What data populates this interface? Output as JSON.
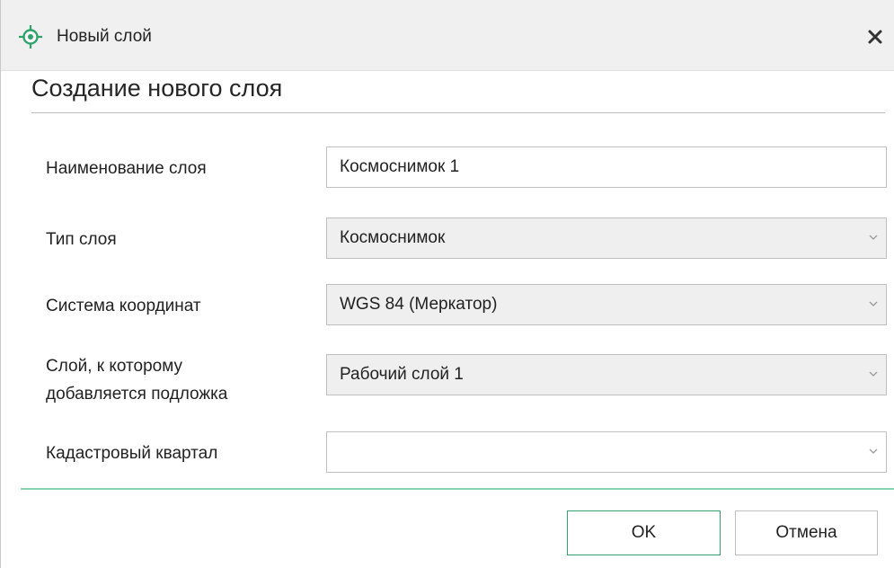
{
  "window": {
    "title": "Новый слой",
    "accent_color": "#2fa36b"
  },
  "dialog": {
    "heading": "Создание нового слоя"
  },
  "form": {
    "layer_name": {
      "label": "Наименование слоя",
      "value": "Космоснимок 1"
    },
    "layer_type": {
      "label": "Тип слоя",
      "value": "Космоснимок"
    },
    "coord_system": {
      "label": "Система координат",
      "value": "WGS 84 (Меркатор)"
    },
    "target_layer": {
      "label_line1": "Слой, к которому",
      "label_line2": "добавляется подложка",
      "value": "Рабочий слой 1"
    },
    "cadastral_block": {
      "label": "Кадастровый квартал",
      "value": ""
    }
  },
  "buttons": {
    "ok": "OK",
    "cancel": "Отмена"
  },
  "icons": {
    "app": "layer-crosshair-icon",
    "close": "close-icon",
    "dropdown": "chevron-down-icon"
  }
}
